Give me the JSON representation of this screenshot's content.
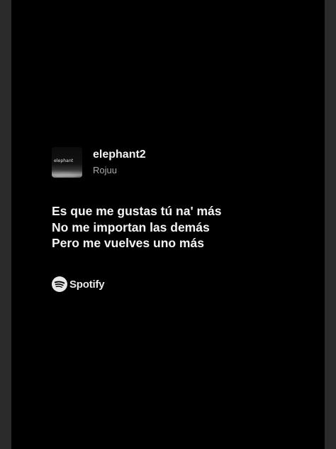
{
  "track": {
    "cover_text": "elephant",
    "title": "elephant2",
    "artist": "Rojuu"
  },
  "lyrics": [
    "Es que me gustas tú na' más",
    "No me importan las demás",
    "Pero me vuelves uno más"
  ],
  "brand": {
    "icon": "spotify-icon",
    "name": "Spotify"
  },
  "colors": {
    "card_background": "#000000",
    "outer_background": "#2b2b2b",
    "text_primary": "#f2f2f2",
    "text_secondary": "#a8a8a8"
  }
}
